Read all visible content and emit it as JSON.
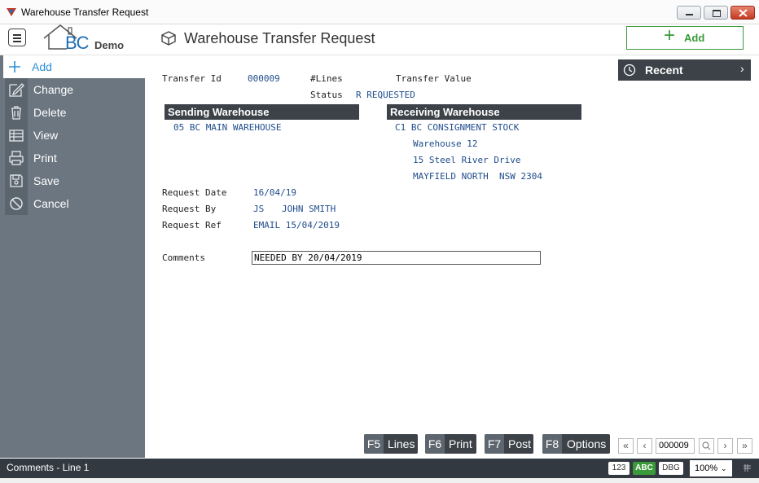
{
  "window": {
    "title": "Warehouse Transfer Request"
  },
  "header": {
    "logo_text": "BC",
    "logo_suffix": "Demo",
    "page_title": "Warehouse Transfer Request",
    "add_label": "Add"
  },
  "sidebar": {
    "items": [
      {
        "label": "Add",
        "icon": "plus-icon"
      },
      {
        "label": "Change",
        "icon": "edit-icon"
      },
      {
        "label": "Delete",
        "icon": "trash-icon"
      },
      {
        "label": "View",
        "icon": "table-icon"
      },
      {
        "label": "Print",
        "icon": "printer-icon"
      },
      {
        "label": "Save",
        "icon": "save-icon"
      },
      {
        "label": "Cancel",
        "icon": "cancel-icon"
      }
    ]
  },
  "recent": {
    "label": "Recent"
  },
  "form": {
    "transfer_id_label": "Transfer Id",
    "transfer_id": "000009",
    "lines_label": "#Lines",
    "transfer_value_label": "Transfer Value",
    "status_label": "Status",
    "status_value": "R REQUESTED",
    "sending": {
      "header": "Sending Warehouse",
      "value": "05 BC MAIN WAREHOUSE"
    },
    "receiving": {
      "header": "Receiving Warehouse",
      "code_name": "C1 BC CONSIGNMENT STOCK",
      "addr1": "Warehouse 12",
      "addr2": "15 Steel River Drive",
      "addr3": "MAYFIELD NORTH  NSW 2304"
    },
    "request_date_label": "Request Date",
    "request_date": "16/04/19",
    "request_by_label": "Request By",
    "request_by_code": "JS",
    "request_by_name": "JOHN SMITH",
    "request_ref_label": "Request Ref",
    "request_ref": "EMAIL 15/04/2019",
    "comments_label": "Comments",
    "comments_value": "NEEDED BY 20/04/2019"
  },
  "function_keys": [
    {
      "key": "F5",
      "label": "Lines"
    },
    {
      "key": "F6",
      "label": "Print"
    },
    {
      "key": "F7",
      "label": "Post"
    },
    {
      "key": "F8",
      "label": "Options"
    }
  ],
  "navigator": {
    "record": "000009"
  },
  "status": {
    "text": "Comments - Line 1",
    "badge_123": "123",
    "badge_abc": "ABC",
    "badge_dbg": "DBG",
    "zoom": "100%"
  },
  "colors": {
    "sidebar": "#6b7680",
    "dark": "#3c4248",
    "accent_blue": "#2b8fd6",
    "add_green": "#3a9a3a",
    "value_blue": "#1f4c8c"
  }
}
